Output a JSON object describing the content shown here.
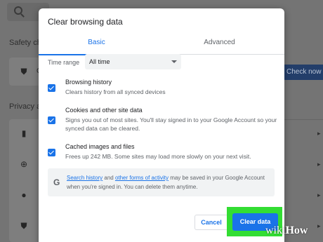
{
  "background": {
    "safety_heading": "Safety ch",
    "privacy_heading": "Privacy a",
    "safety_row_text": "C",
    "check_now_label": "Check now"
  },
  "dialog": {
    "title": "Clear browsing data",
    "tabs": [
      {
        "label": "Basic",
        "selected": true
      },
      {
        "label": "Advanced",
        "selected": false
      }
    ],
    "time_range": {
      "label": "Time range",
      "value": "All time"
    },
    "items": [
      {
        "title": "Browsing history",
        "description": "Clears history from all synced devices",
        "checked": true
      },
      {
        "title": "Cookies and other site data",
        "description": "Signs you out of most sites. You'll stay signed in to your Google Account so your synced data can be cleared.",
        "checked": true
      },
      {
        "title": "Cached images and files",
        "description": "Frees up 242 MB. Some sites may load more slowly on your next visit.",
        "checked": true
      }
    ],
    "info": {
      "link1": "Search history",
      "text1": " and ",
      "link2": "other forms of activity",
      "text2": " may be saved in your Google Account when you're signed in. You can delete them anytime."
    },
    "cancel_label": "Cancel",
    "clear_label": "Clear data"
  },
  "watermark": {
    "prefix": "wiki",
    "suffix": "How"
  },
  "colors": {
    "accent": "#1a73e8",
    "highlight": "#33dd33"
  }
}
